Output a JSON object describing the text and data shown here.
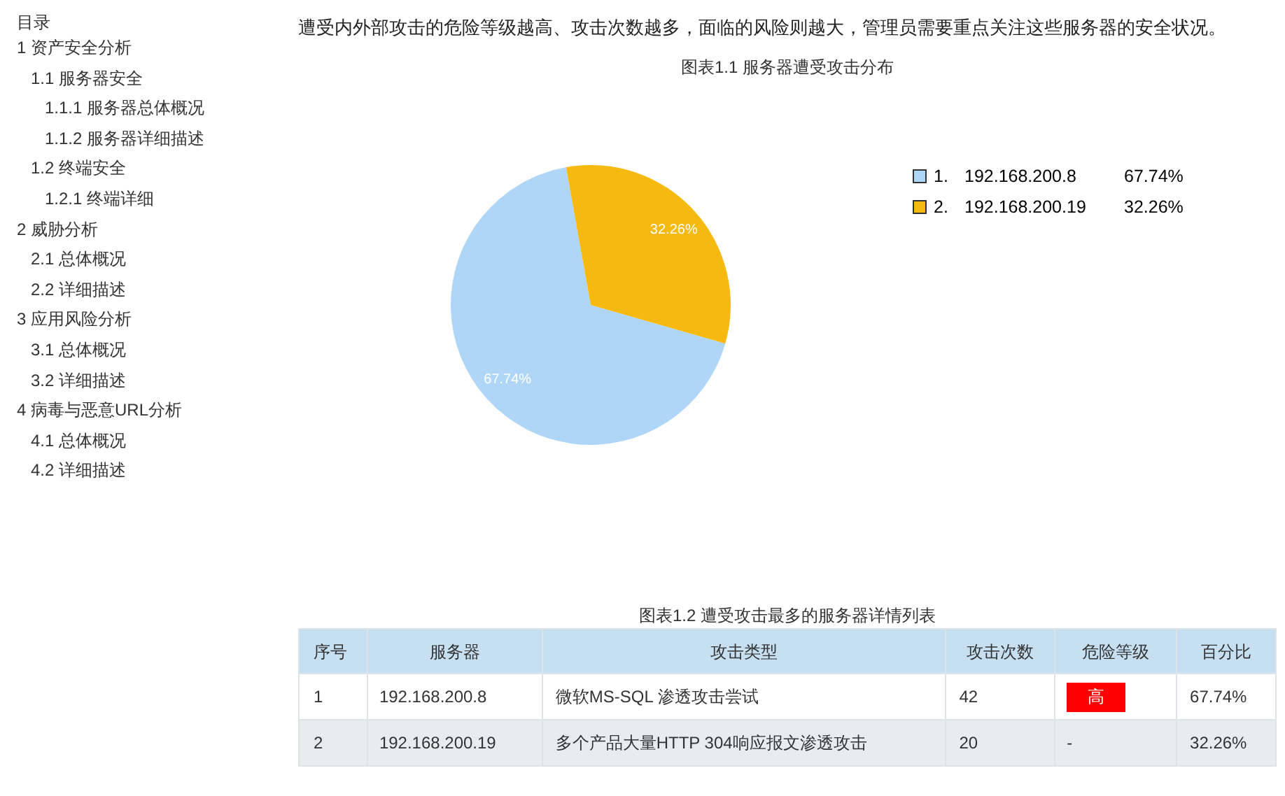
{
  "toc": {
    "title": "目录",
    "items": [
      {
        "label": "1 资产安全分析",
        "children": [
          {
            "label": "1.1 服务器安全",
            "children": [
              {
                "label": "1.1.1 服务器总体概况"
              },
              {
                "label": "1.1.2 服务器详细描述"
              }
            ]
          },
          {
            "label": "1.2 终端安全",
            "children": [
              {
                "label": "1.2.1 终端详细"
              }
            ]
          }
        ]
      },
      {
        "label": "2 威胁分析",
        "children": [
          {
            "label": "2.1 总体概况"
          },
          {
            "label": "2.2 详细描述"
          }
        ]
      },
      {
        "label": "3 应用风险分析",
        "children": [
          {
            "label": "3.1 总体概况"
          },
          {
            "label": "3.2 详细描述"
          }
        ]
      },
      {
        "label": "4 病毒与恶意URL分析",
        "children": [
          {
            "label": "4.1 总体概况"
          },
          {
            "label": "4.2 详细描述"
          }
        ]
      }
    ]
  },
  "intro": "遭受内外部攻击的危险等级越高、攻击次数越多，面临的风险则越大，管理员需要重点关注这些服务器的安全状况。",
  "pie": {
    "chart_data": {
      "type": "pie",
      "title": "图表1.1 服务器遭受攻击分布",
      "categories": [
        "192.168.200.8",
        "192.168.200.19"
      ],
      "values": [
        67.74,
        32.26
      ],
      "value_labels": [
        "67.74%",
        "32.26%"
      ]
    },
    "legend": [
      {
        "index": "1.",
        "value": "67.74%",
        "color": "#afd6f6"
      },
      {
        "index": "2.",
        "value": "32.26%",
        "color": "#f5b90f"
      }
    ]
  },
  "table": {
    "title": "图表1.2 遭受攻击最多的服务器详情列表",
    "columns": [
      "序号",
      "服务器",
      "攻击类型",
      "攻击次数",
      "危险等级",
      "百分比"
    ],
    "rows": [
      {
        "cells": [
          "1",
          "192.168.200.8",
          "微软MS-SQL 渗透攻击尝试",
          "42"
        ],
        "risk": {
          "kind": "badge",
          "text": "高",
          "color": "#ff0000"
        },
        "percent": "67.74%"
      },
      {
        "cells": [
          "2",
          "192.168.200.19",
          "多个产品大量HTTP 304响应报文渗透攻击",
          "20"
        ],
        "risk": {
          "kind": "plain",
          "text": "-"
        },
        "percent": "32.26%"
      }
    ]
  }
}
